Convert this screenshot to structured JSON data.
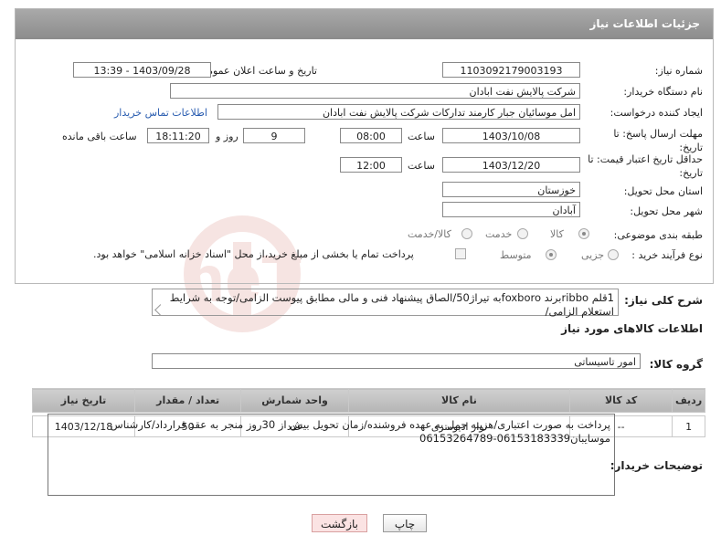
{
  "header": {
    "title": "جزئیات اطلاعات نیاز"
  },
  "fields": {
    "need_number_label": "شماره نیاز:",
    "need_number": "1103092179003193",
    "announce_label": "تاریخ و ساعت اعلان عمومی:",
    "announce_value": "1403/09/28 - 13:39",
    "buyer_org_label": "نام دستگاه خریدار:",
    "buyer_org": "شرکت پالایش نفت ابادان",
    "requester_label": "ایجاد کننده درخواست:",
    "requester": "امل موسائیان جبار کارمند تدارکات شرکت پالایش نفت ابادان",
    "contact_link": "اطلاعات تماس خریدار",
    "deadline_label": "مهلت ارسال پاسخ: تا تاریخ:",
    "deadline_date": "1403/10/08",
    "time_label": "ساعت",
    "deadline_time": "08:00",
    "days_value": "9",
    "days_and": "روز و",
    "remaining_time": "18:11:20",
    "remaining_label": "ساعت باقی مانده",
    "price_validity_label": "حداقل تاریخ اعتبار قیمت: تا تاریخ:",
    "price_validity_date": "1403/12/20",
    "price_validity_time": "12:00",
    "province_label": "استان محل تحویل:",
    "province": "خوزستان",
    "city_label": "شهر محل تحویل:",
    "city": "آبادان",
    "category_label": "طبقه بندی موضوعی:",
    "category_options": [
      "کالا",
      "خدمت",
      "کالا/خدمت"
    ],
    "process_label": "نوع فرآیند خرید :",
    "process_options": [
      "جزیی",
      "متوسط"
    ],
    "payment_note": "پرداخت تمام یا بخشی از مبلغ خرید،از محل \"اسناد خزانه اسلامی\" خواهد بود."
  },
  "description": {
    "label": "شرح کلی نیاز:",
    "text": "1قلم ribboبرند foxboroبه تیراژ50/الصاق پیشنهاد فنی و مالی مطابق پیوست الزامی/توجه به شرایط استعلام الزامی/"
  },
  "goods": {
    "section_title": "اطلاعات کالاهای مورد نیاز",
    "group_label": "گروه کالا:",
    "group_value": "امور تاسیساتی",
    "columns": [
      "ردیف",
      "کد کالا",
      "نام کالا",
      "واحد شمارش",
      "تعداد / مقدار",
      "تاریخ نیاز"
    ],
    "rows": [
      {
        "index": "1",
        "code": "--",
        "name": "نوار ادیومتری",
        "unit": "عدد",
        "qty": "50",
        "date": "1403/12/18"
      }
    ]
  },
  "buyer_notes": {
    "label": "توضیحات خریدار:",
    "text": "پرداخت به صورت اعتباری/هزینه حمل به عهده فروشنده/زمان تحویل بیش از 30روز منجر به عقد قرارداد/کارشناس موسایبان06153183339-06153264789"
  },
  "buttons": {
    "print": "چاپ",
    "back": "بازگشت"
  },
  "watermark": "AriaTender.neT"
}
